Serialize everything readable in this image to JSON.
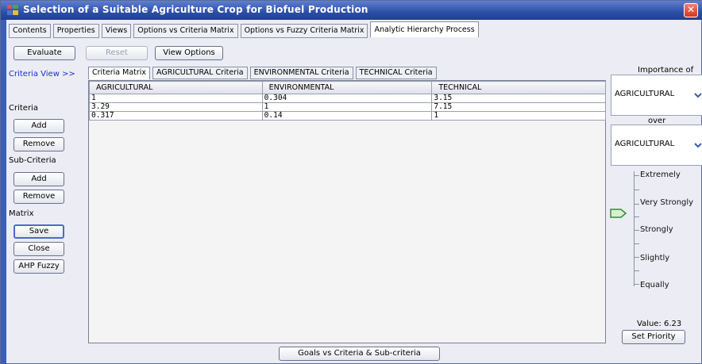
{
  "window": {
    "title": "Selection of a Suitable Agriculture Crop for Biofuel Production",
    "close_glyph": "✕"
  },
  "main_tabs": [
    {
      "label": "Contents"
    },
    {
      "label": "Properties"
    },
    {
      "label": "Views"
    },
    {
      "label": "Options vs Criteria Matrix"
    },
    {
      "label": "Options vs Fuzzy Criteria Matrix"
    },
    {
      "label": "Analytic Hierarchy Process"
    }
  ],
  "toolbar": {
    "evaluate": "Evaluate",
    "reset": "Reset",
    "view_options": "View Options"
  },
  "left_panel": {
    "criteria_view": "Criteria View >>",
    "criteria": "Criteria",
    "add": "Add",
    "remove": "Remove",
    "sub_criteria": "Sub-Criteria",
    "sub_add": "Add",
    "sub_remove": "Remove",
    "matrix": "Matrix",
    "save": "Save",
    "close": "Close",
    "ahp_fuzzy": "AHP Fuzzy"
  },
  "sub_tabs": [
    {
      "label": "Criteria Matrix"
    },
    {
      "label": "AGRICULTURAL Criteria"
    },
    {
      "label": "ENVIRONMENTAL Criteria"
    },
    {
      "label": "TECHNICAL Criteria"
    }
  ],
  "matrix": {
    "headers": [
      "AGRICULTURAL",
      "ENVIRONMENTAL",
      "TECHNICAL"
    ],
    "rows": [
      [
        "1",
        "0.304",
        "3.15"
      ],
      [
        "3.29",
        "1",
        "7.15"
      ],
      [
        "0.317",
        "0.14",
        "1"
      ]
    ]
  },
  "right_panel": {
    "importance_of": "Importance of",
    "combo1_value": "AGRICULTURAL",
    "over": "over",
    "combo2_value": "AGRICULTURAL",
    "scale": [
      "Extremely",
      "Very Strongly",
      "Strongly",
      "Slightly",
      "Equally"
    ],
    "value_text": "Value: 6.23",
    "set_priority": "Set Priority"
  },
  "footer": {
    "goals_button": "Goals vs Criteria & Sub-criteria"
  },
  "colors": {
    "title_bar": "#2b4fa8",
    "accent_blue": "#1a2fc0",
    "close_red": "#d4381f"
  }
}
